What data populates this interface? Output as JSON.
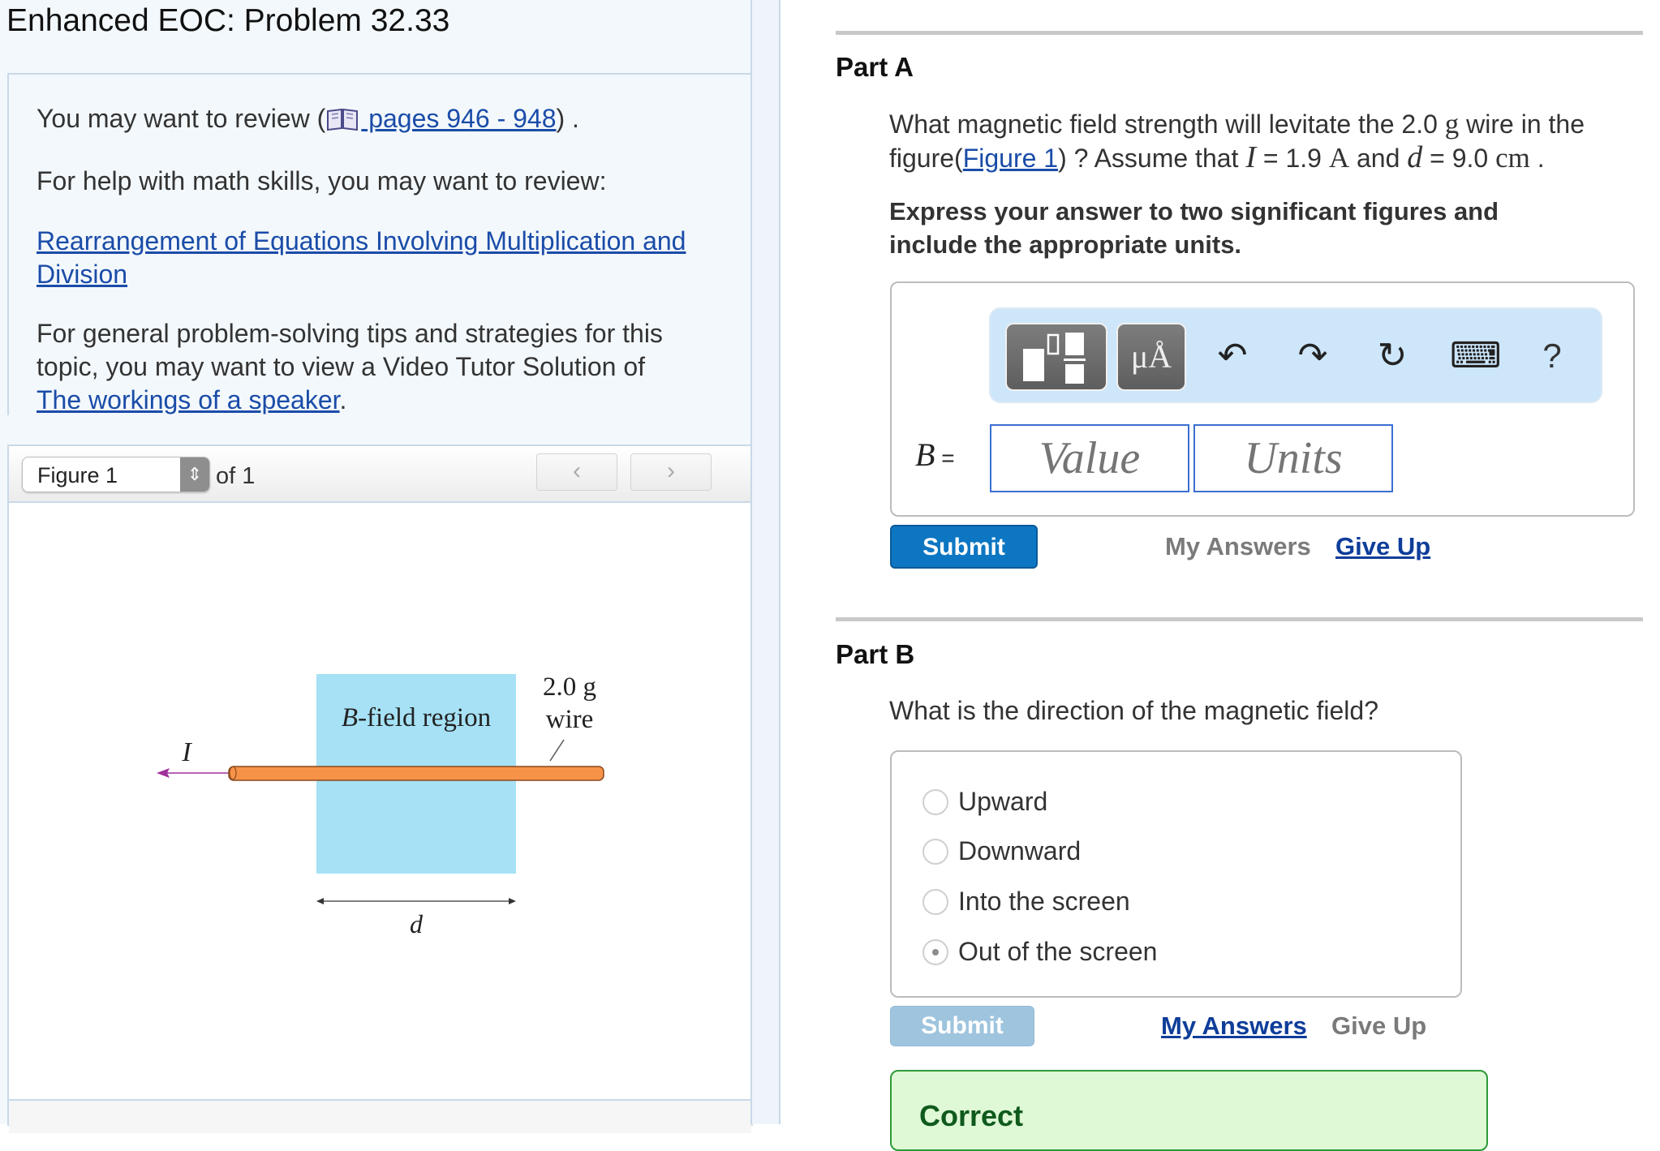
{
  "page": {
    "title": "Enhanced EOC: Problem 32.33"
  },
  "review": {
    "line1_prefix": "You may want to review (",
    "book_icon": "book-icon",
    "pages_link": " pages 946 - 948",
    "line1_suffix": ") .",
    "math_help": "For help with math skills, you may want to review:",
    "math_link_line1": "Rearrangement of Equations Involving Multiplication and",
    "math_link_line2": "Division",
    "tips_line1": "For general problem-solving tips and strategies for this",
    "tips_line2": "topic, you may want to view a Video Tutor Solution of",
    "video_link": "The workings of a speaker",
    "video_suffix": "."
  },
  "figure_panel": {
    "select_value": "Figure 1",
    "select_arrow_icon": "updown-chevron-icon",
    "of_label": "of 1",
    "prev_icon": "‹",
    "next_icon": "›",
    "figure": {
      "region_label_italic": "B",
      "region_label_rest": "-field region",
      "mass_label": "2.0 g",
      "wire_label": "wire",
      "current_label": "I",
      "width_label": "d",
      "region_color": "#a6e1f5",
      "wire_color": "#f79349",
      "current_arrow_color": "#a0309b"
    }
  },
  "part_a": {
    "title": "Part A",
    "question_line1_a": "What magnetic field strength will levitate the 2.0 ",
    "question_line1_unit": "g",
    "question_line1_b": " wire in the",
    "question_line2_a": "figure(",
    "figure_link": "Figure 1",
    "question_line2_b": ") ? Assume that ",
    "var_I": "I",
    "eq_I": " = 1.9 ",
    "unit_A": "A",
    "and": " and ",
    "var_d": "d",
    "eq_d": " = 9.0 ",
    "unit_cm": "cm",
    "end": " .",
    "instructions_line1": "Express your answer to two significant figures and",
    "instructions_line2": "include the appropriate units.",
    "toolbar": {
      "template_icon": "templates-icon",
      "units_label": "μÅ",
      "undo_icon": "↶",
      "redo_icon": "↷",
      "reset_icon": "↻",
      "keyboard_icon": "⌨",
      "help_label": "?"
    },
    "answer_var": "B",
    "answer_eq": " =",
    "value_placeholder": "Value",
    "units_placeholder": "Units",
    "submit_label": "Submit",
    "my_answers_label": "My Answers",
    "give_up_label": "Give Up"
  },
  "part_b": {
    "title": "Part B",
    "question": "What is the direction of the magnetic field?",
    "options": [
      {
        "label": "Upward",
        "selected": false
      },
      {
        "label": "Downward",
        "selected": false
      },
      {
        "label": "Into the screen",
        "selected": false
      },
      {
        "label": "Out of the screen",
        "selected": true
      }
    ],
    "submit_label": "Submit",
    "my_answers_label": "My Answers",
    "give_up_label": "Give Up",
    "result_label": "Correct"
  },
  "colors": {
    "link": "#1a4ca8",
    "submit_active": "#0d76c2",
    "submit_disabled": "#9ec4de",
    "toolbar_bg": "#cde6fa",
    "correct_bg": "#dff8d6",
    "correct_border": "#2e9a3a"
  }
}
